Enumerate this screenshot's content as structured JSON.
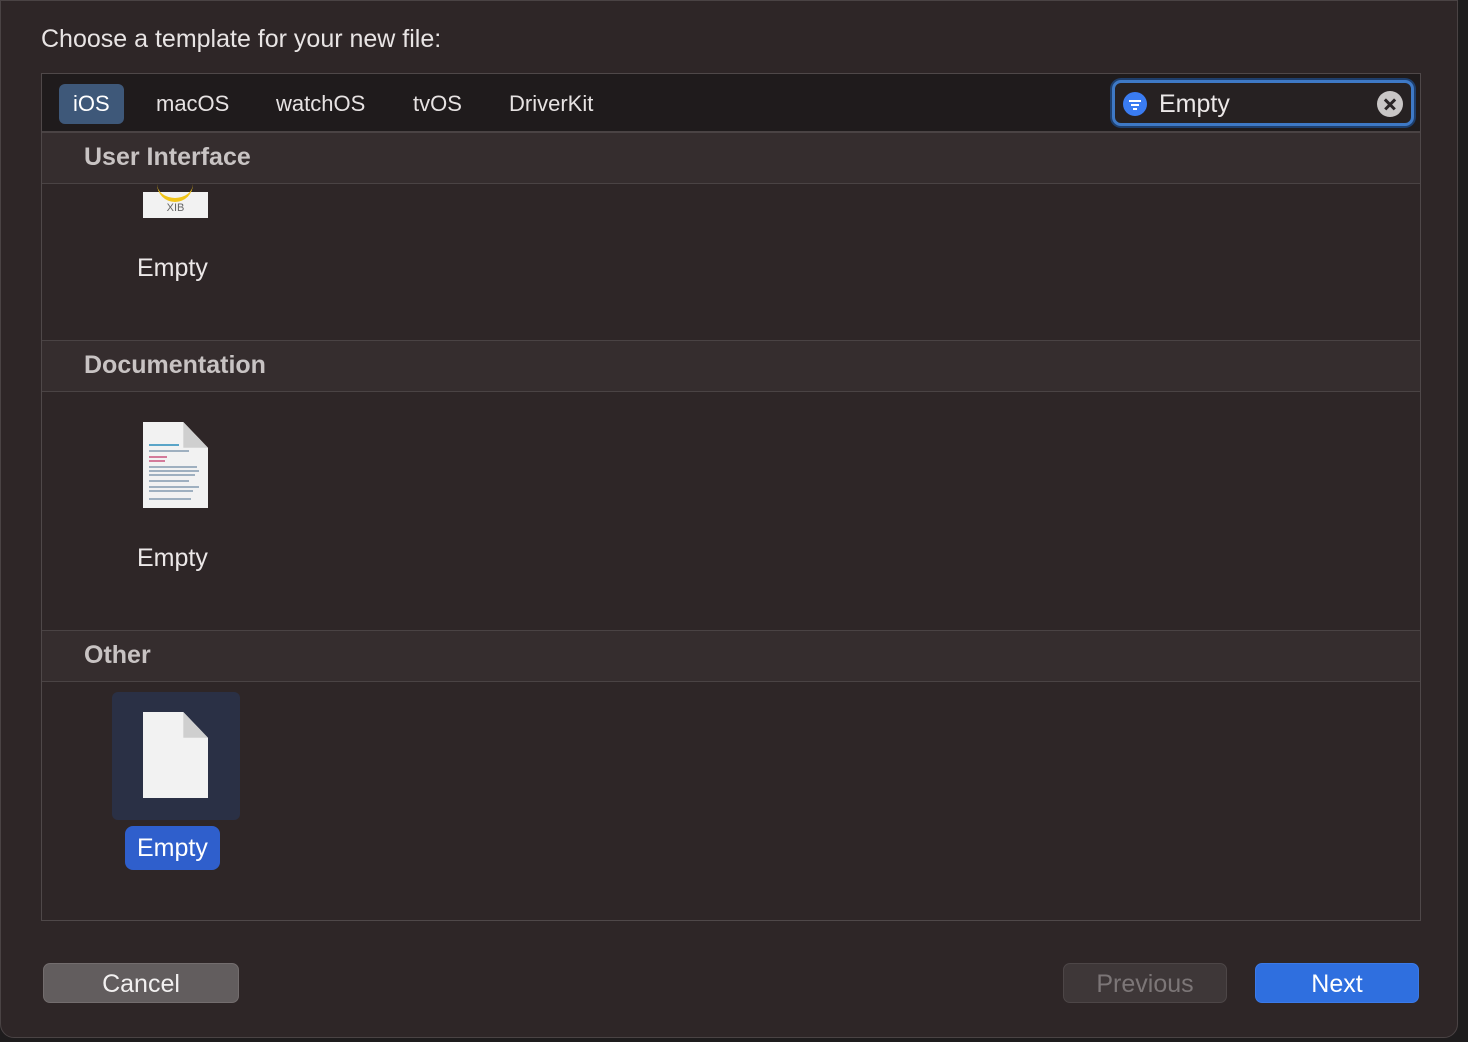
{
  "dialog": {
    "prompt": "Choose a template for your new file:"
  },
  "platforms": {
    "tabs": [
      {
        "label": "iOS",
        "selected": true
      },
      {
        "label": "macOS",
        "selected": false
      },
      {
        "label": "watchOS",
        "selected": false
      },
      {
        "label": "tvOS",
        "selected": false
      },
      {
        "label": "DriverKit",
        "selected": false
      }
    ]
  },
  "search": {
    "value": "Empty",
    "icon": "filter-icon",
    "clear_icon": "clear-icon"
  },
  "sections": [
    {
      "title": "User Interface",
      "templates": [
        {
          "label": "Empty",
          "badge": "XIB",
          "icon": "xib-file-icon",
          "selected": false
        }
      ]
    },
    {
      "title": "Documentation",
      "templates": [
        {
          "label": "Empty",
          "icon": "markdown-file-icon",
          "selected": false
        }
      ]
    },
    {
      "title": "Other",
      "templates": [
        {
          "label": "Empty",
          "icon": "blank-file-icon",
          "selected": true
        }
      ]
    }
  ],
  "buttons": {
    "cancel": "Cancel",
    "previous": "Previous",
    "next": "Next"
  },
  "colors": {
    "accent": "#2f6fdf",
    "selected_tab": "#3e5879",
    "background": "#2e2627"
  }
}
